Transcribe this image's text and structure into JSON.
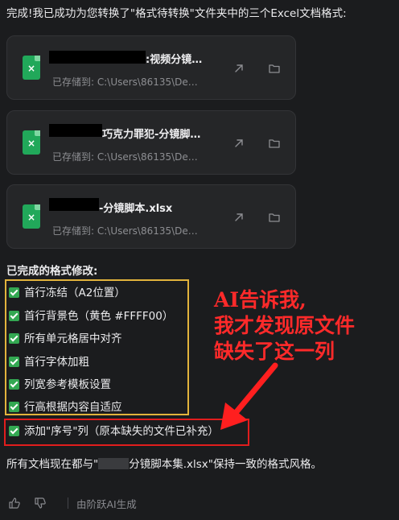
{
  "message": {
    "intro": "完成!我已成功为您转换了\"格式待转换\"文件夹中的三个Excel文档格式:",
    "files": [
      {
        "name": ":视频分镜…",
        "path": "已存储到: C:\\Users\\86135\\De…",
        "icon": "excel-file-icon"
      },
      {
        "name": "巧克力罪犯-分镜脚…",
        "path": "已存储到: C:\\Users\\86135\\De…",
        "icon": "excel-file-icon"
      },
      {
        "name": "-分镜脚本.xlsx",
        "path": "已存储到: C:\\Users\\86135\\De…",
        "icon": "excel-file-icon"
      }
    ],
    "section_title": "已完成的格式修改:",
    "changes": [
      "首行冻结（A2位置）",
      "首行背景色（黄色 #FFFF00）",
      "所有单元格居中对齐",
      "首行字体加粗",
      "列宽参考模板设置",
      "行高根据内容自适应",
      "添加\"序号\"列（原本缺失的文件已补充）"
    ],
    "summary_before": "所有文档现在都与\"",
    "summary_after": "分镜脚本集.xlsx\"保持一致的格式风格。"
  },
  "annotation": {
    "lines": [
      "AI告诉我,",
      "我才发现原文件",
      "缺失了这一列"
    ],
    "color": "#ff2a2a"
  },
  "footer": {
    "generated_by": "由阶跃AI生成"
  },
  "colors": {
    "background": "#1b1c1e",
    "card": "#252628",
    "excel_green": "#21a85a",
    "check_green": "#33a852",
    "highlight_yellow": "#e2b33c",
    "highlight_red": "#e11d1d"
  }
}
